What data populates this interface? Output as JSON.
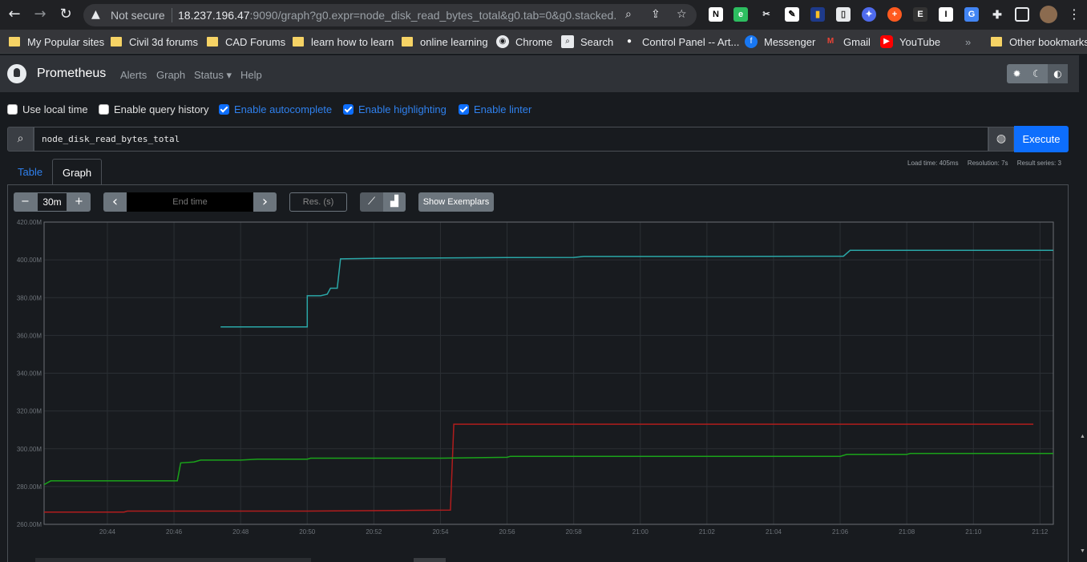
{
  "browser": {
    "security_label": "Not secure",
    "url_host": "18.237.196.47",
    "url_rest": ":9090/graph?g0.expr=node_disk_read_bytes_total&g0.tab=0&g0.stacked...",
    "bookmarks": [
      {
        "label": "My Popular sites",
        "type": "folder"
      },
      {
        "label": "Civil 3d forums",
        "type": "folder"
      },
      {
        "label": "CAD Forums",
        "type": "folder"
      },
      {
        "label": "learn how to learn",
        "type": "folder"
      },
      {
        "label": "online learning",
        "type": "folder"
      },
      {
        "label": "Chrome",
        "type": "site"
      },
      {
        "label": "Search",
        "type": "site"
      },
      {
        "label": "Control Panel -- Art...",
        "type": "site"
      },
      {
        "label": "Messenger",
        "type": "site"
      },
      {
        "label": "Gmail",
        "type": "site"
      },
      {
        "label": "YouTube",
        "type": "site"
      }
    ],
    "more_label": "»",
    "other_bookmarks": "Other bookmarks"
  },
  "nav": {
    "brand": "Prometheus",
    "links": [
      "Alerts",
      "Graph",
      "Status ▾",
      "Help"
    ]
  },
  "options": [
    {
      "label": "Use local time",
      "checked": false
    },
    {
      "label": "Enable query history",
      "checked": false
    },
    {
      "label": "Enable autocomplete",
      "checked": true
    },
    {
      "label": "Enable highlighting",
      "checked": true
    },
    {
      "label": "Enable linter",
      "checked": true
    }
  ],
  "query": {
    "expr": "node_disk_read_bytes_total",
    "execute_label": "Execute"
  },
  "tabs": {
    "table": "Table",
    "graph": "Graph"
  },
  "stats": {
    "load_time": "Load time: 405ms",
    "resolution": "Resolution: 7s",
    "result_series": "Result series: 3"
  },
  "controls": {
    "minus": "−",
    "range": "30m",
    "plus": "+",
    "prev": "‹",
    "end_time_placeholder": "End time",
    "next": "›",
    "res_placeholder": "Res. (s)",
    "show_exemplars": "Show Exemplars"
  },
  "colors": {
    "series_teal": "#2aa7a7",
    "series_red": "#b01d1d",
    "series_green": "#1aa31a",
    "accent": "#0d6efd"
  },
  "chart_data": {
    "type": "line",
    "ylim": [
      260000000,
      420000000
    ],
    "yticks": [
      "420.00M",
      "400.00M",
      "380.00M",
      "360.00M",
      "340.00M",
      "320.00M",
      "300.00M",
      "280.00M",
      "260.00M"
    ],
    "xticks": [
      "20:44",
      "20:46",
      "20:48",
      "20:50",
      "20:52",
      "20:54",
      "20:56",
      "20:58",
      "21:00",
      "21:02",
      "21:04",
      "21:06",
      "21:08",
      "21:10",
      "21:12"
    ],
    "xlim_minutes": [
      42.1,
      72.4
    ],
    "series": [
      {
        "color": "#2aa7a7",
        "points": [
          [
            47.4,
            364.5
          ],
          [
            50.0,
            364.5
          ],
          [
            50.0,
            381
          ],
          [
            50.4,
            381
          ],
          [
            50.6,
            381.8
          ],
          [
            50.7,
            385
          ],
          [
            50.9,
            385
          ],
          [
            51.0,
            400.5
          ],
          [
            52.0,
            400.8
          ],
          [
            54.0,
            401
          ],
          [
            56.0,
            401.2
          ],
          [
            58.0,
            401.3
          ],
          [
            58.3,
            401.8
          ],
          [
            60.0,
            401.8
          ],
          [
            62.0,
            401.8
          ],
          [
            66.0,
            401.9
          ],
          [
            66.1,
            401.9
          ],
          [
            66.3,
            405
          ],
          [
            68.0,
            405
          ],
          [
            72.4,
            405
          ]
        ]
      },
      {
        "color": "#b01d1d",
        "points": [
          [
            42.1,
            266.5
          ],
          [
            44.5,
            266.5
          ],
          [
            44.6,
            267
          ],
          [
            50.0,
            267
          ],
          [
            54.3,
            267.5
          ],
          [
            54.4,
            313
          ],
          [
            60.0,
            313
          ],
          [
            71.8,
            313
          ]
        ]
      },
      {
        "color": "#1aa31a",
        "points": [
          [
            42.1,
            281
          ],
          [
            42.3,
            283
          ],
          [
            46.0,
            283
          ],
          [
            46.1,
            283
          ],
          [
            46.2,
            292.5
          ],
          [
            46.6,
            293
          ],
          [
            46.8,
            294
          ],
          [
            48.0,
            294
          ],
          [
            48.5,
            294.5
          ],
          [
            50.0,
            294.5
          ],
          [
            50.1,
            295
          ],
          [
            54.0,
            295
          ],
          [
            56.0,
            295.5
          ],
          [
            56.1,
            296
          ],
          [
            60.0,
            296
          ],
          [
            66.0,
            296
          ],
          [
            66.2,
            297
          ],
          [
            68.0,
            297
          ],
          [
            68.1,
            297.5
          ],
          [
            72.4,
            297.5
          ]
        ]
      }
    ]
  }
}
